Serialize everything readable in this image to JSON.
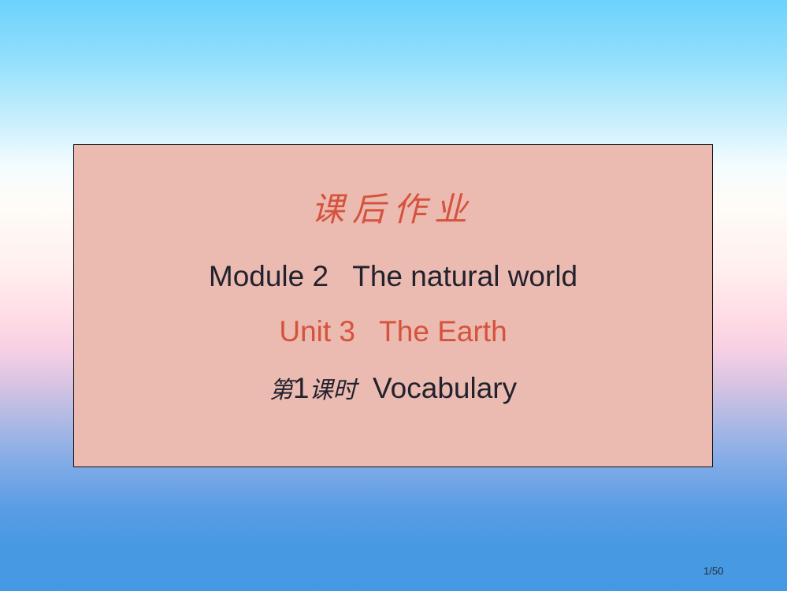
{
  "slide": {
    "title_cn": "课后作业",
    "module_line": "Module 2   The natural world",
    "unit_line": "Unit 3   The Earth",
    "lesson_prefix_cn": "第",
    "lesson_number": "1",
    "lesson_suffix_cn": "课时",
    "lesson_topic": "Vocabulary"
  },
  "footer": {
    "page_indicator": "1/50"
  },
  "colors": {
    "card_background": "#ebbab0",
    "accent_red": "#d5533c",
    "text_dark": "#22222e",
    "gradient_top": "#6cd2fd",
    "gradient_bottom": "#4599e2"
  }
}
